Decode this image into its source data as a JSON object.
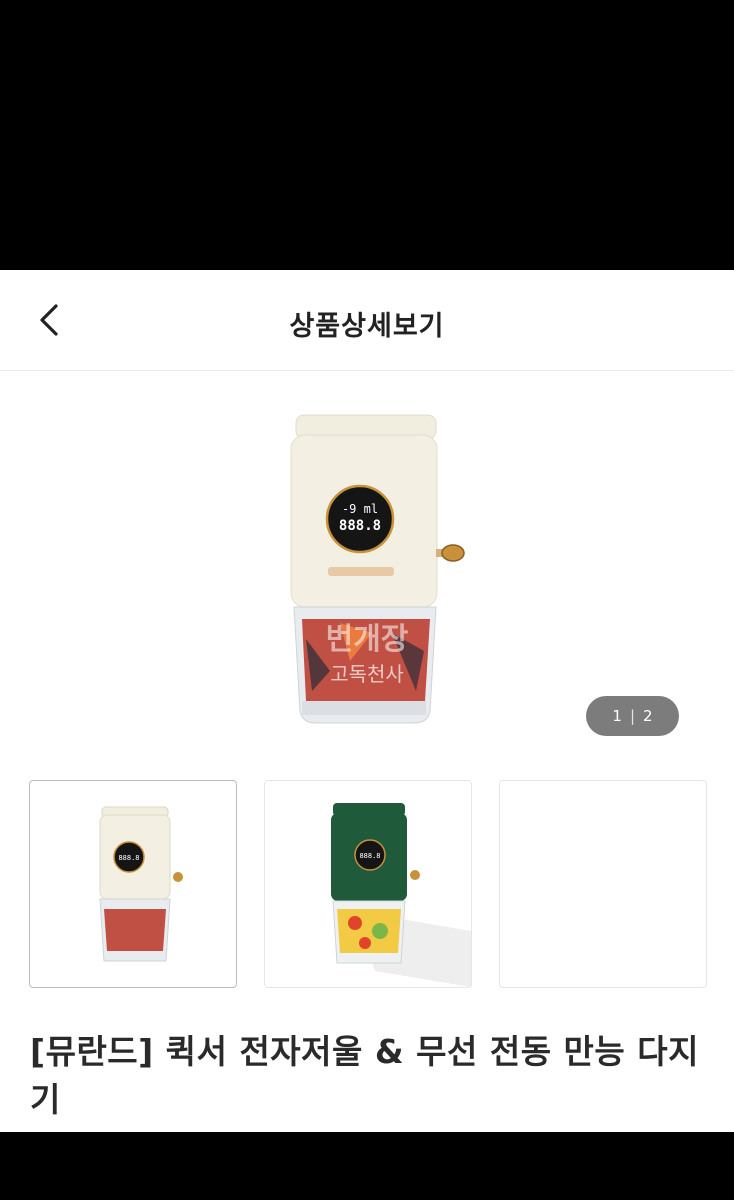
{
  "header": {
    "title": "상품상세보기",
    "back_icon": "chevron-left-icon"
  },
  "gallery": {
    "current_page": "1",
    "separator": "|",
    "total_pages": "2",
    "main_image_display_lines": [
      "-9 ml",
      "888.8"
    ],
    "watermark_line_1": "번개장",
    "watermark_line_2": "고독천사",
    "thumb_1_display": "888.8",
    "thumb_2_display": "888.8",
    "colors": {
      "cream": "#f3efe2",
      "green": "#1f5a3a",
      "gold": "#c8913a"
    }
  },
  "product": {
    "name": "[뮤란드] 퀵서 전자저울 & 무선 전동 만능 다지기"
  }
}
